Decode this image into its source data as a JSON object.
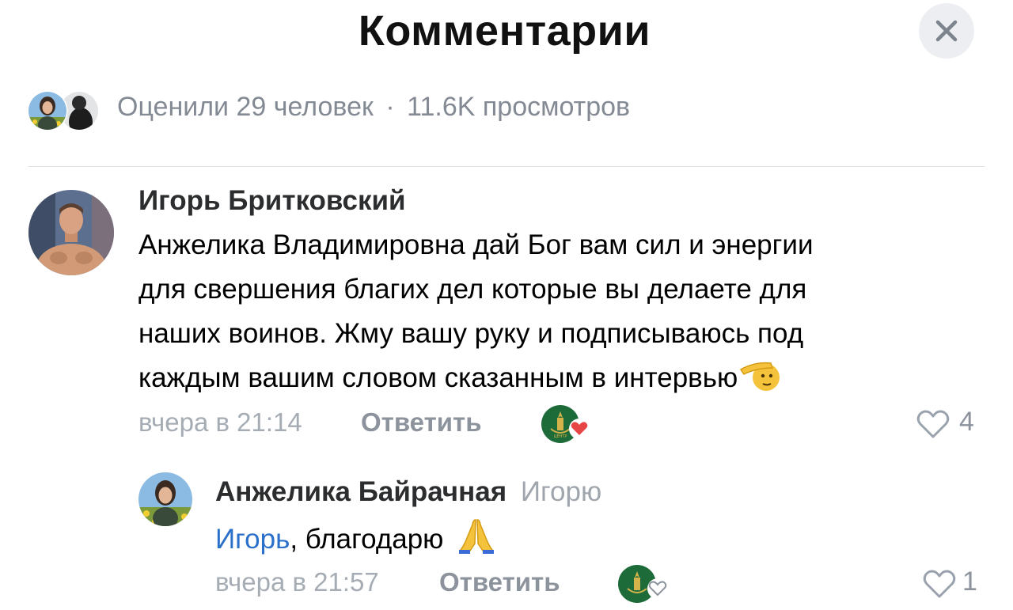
{
  "header": {
    "title": "Комментарии"
  },
  "stats": {
    "likes_text": "Оценили 29 человек",
    "separator": "·",
    "views_text": "11.6K просмотров"
  },
  "comments": [
    {
      "author": "Игорь Бритковский",
      "text_lines": [
        "Анжелика Владимировна дай Бог вам сил и энергии",
        "для свершения благих дел которые вы делаете для",
        "наших воинов. Жму вашу руку и подписываюсь под",
        "каждым вашим словом сказанным в интервью"
      ],
      "emoji": "🫡",
      "time": "вчера в 21:14",
      "reply_label": "Ответить",
      "likes": "4"
    },
    {
      "author": "Анжелика Байрачная",
      "reply_to": "Игорю",
      "mention": "Игорь",
      "text": ", благодарю",
      "emoji": "🙏",
      "time": "вчера в 21:57",
      "reply_label": "Ответить",
      "likes": "1"
    }
  ],
  "colors": {
    "accent_blue": "#2a6fc9",
    "secondary_text": "#848a94",
    "badge_green": "#1e6b3a",
    "heart_red": "#e64646"
  },
  "icons": [
    "close-icon",
    "heart-outline-icon",
    "heart-filled-icon",
    "saluting-face-emoji",
    "folded-hands-emoji"
  ]
}
